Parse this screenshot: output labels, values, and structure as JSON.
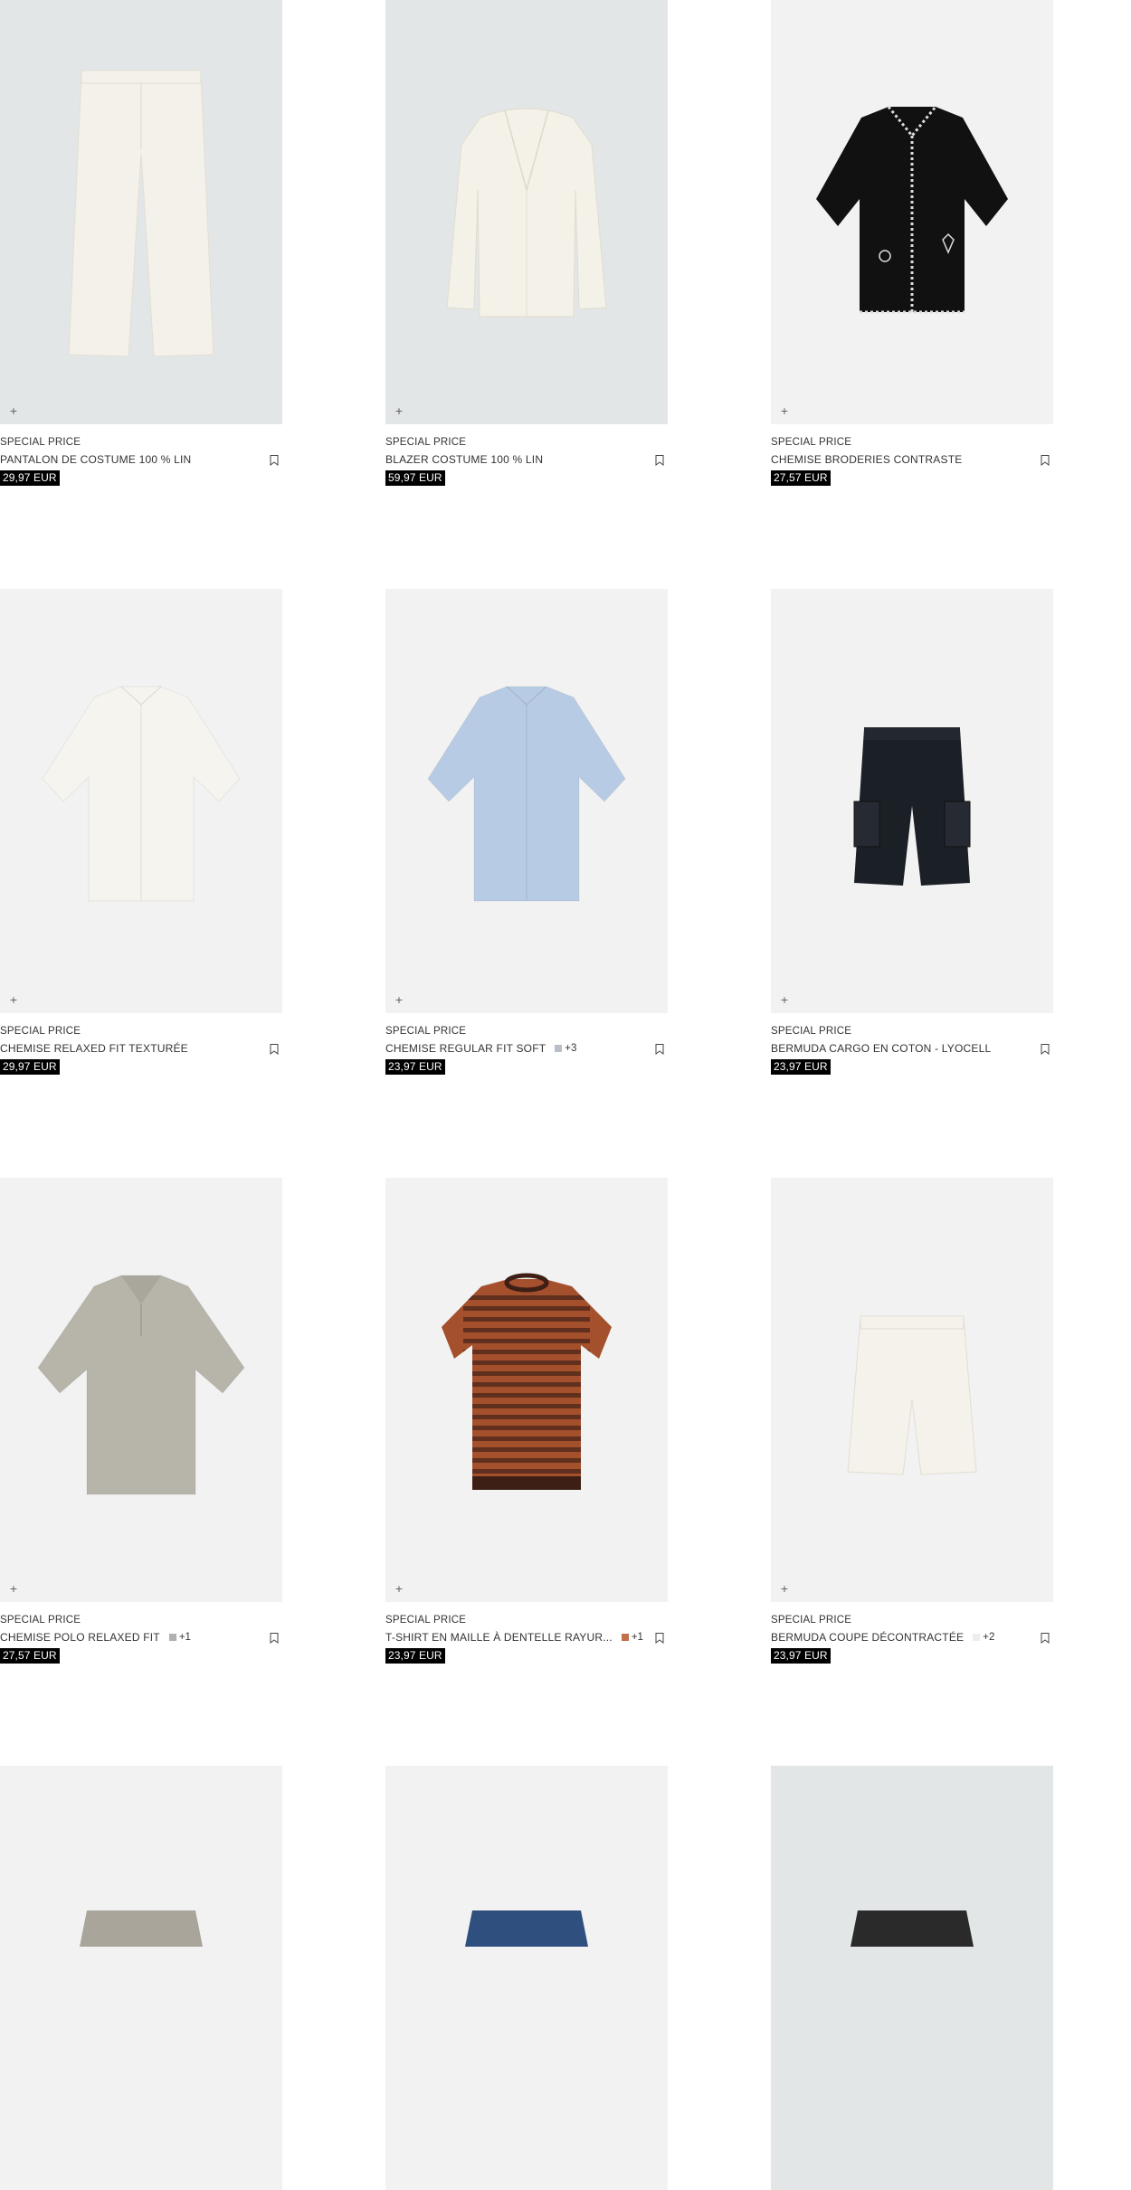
{
  "products": [
    {
      "tag": "SPECIAL PRICE",
      "name": "PANTALON DE COSTUME 100 % LIN",
      "price": "29,97 EUR",
      "bg": "#e3e6e7",
      "garment": "trousers",
      "color": "#f3f1ea",
      "swatch": null,
      "more": ""
    },
    {
      "tag": "SPECIAL PRICE",
      "name": "BLAZER COSTUME 100 % LIN",
      "price": "59,97 EUR",
      "bg": "#e3e6e7",
      "garment": "blazer",
      "color": "#f4f1e8",
      "swatch": null,
      "more": ""
    },
    {
      "tag": "SPECIAL PRICE",
      "name": "CHEMISE BRODERIES CONTRASTE",
      "price": "27,57 EUR",
      "bg": "#f2f2f2",
      "garment": "shirt-dark",
      "color": "#111111",
      "swatch": null,
      "more": ""
    },
    {
      "tag": "SPECIAL PRICE",
      "name": "CHEMISE RELAXED FIT TEXTURÉE",
      "price": "29,97 EUR",
      "bg": "#f2f2f2",
      "garment": "shirt",
      "color": "#f6f4ee",
      "swatch": null,
      "more": ""
    },
    {
      "tag": "SPECIAL PRICE",
      "name": "CHEMISE REGULAR FIT SOFT",
      "price": "23,97 EUR",
      "bg": "#f2f2f2",
      "garment": "shirt",
      "color": "#b8cbe4",
      "swatch": "#b9bfc6",
      "more": "+3"
    },
    {
      "tag": "SPECIAL PRICE",
      "name": "BERMUDA CARGO EN COTON - LYOCELL",
      "price": "23,97 EUR",
      "bg": "#f2f2f2",
      "garment": "cargo",
      "color": "#1b1f26",
      "swatch": null,
      "more": ""
    },
    {
      "tag": "SPECIAL PRICE",
      "name": "CHEMISE POLO RELAXED FIT",
      "price": "27,57 EUR",
      "bg": "#f2f2f2",
      "garment": "polo",
      "color": "#b7b4aa",
      "swatch": "#b0b0b0",
      "more": "+1"
    },
    {
      "tag": "SPECIAL PRICE",
      "name": "T-SHIRT EN MAILLE À DENTELLE RAYUR...",
      "price": "23,97 EUR",
      "bg": "#f2f2f2",
      "garment": "tee-stripe",
      "color": "#a5502d",
      "swatch": "#c0704a",
      "more": "+1"
    },
    {
      "tag": "SPECIAL PRICE",
      "name": "BERMUDA COUPE DÉCONTRACTÉE",
      "price": "23,97 EUR",
      "bg": "#f2f2f2",
      "garment": "shorts",
      "color": "#f4f2ea",
      "swatch": "#ededed",
      "more": "+2"
    },
    {
      "tag": "",
      "name": "",
      "price": "",
      "bg": "#f2f2f2",
      "garment": "partial",
      "color": "#a9a59b",
      "swatch": null,
      "more": ""
    },
    {
      "tag": "",
      "name": "",
      "price": "",
      "bg": "#f2f2f2",
      "garment": "partial",
      "color": "#2f4f7f",
      "swatch": null,
      "more": ""
    },
    {
      "tag": "",
      "name": "",
      "price": "",
      "bg": "#e3e6e7",
      "garment": "partial",
      "color": "#2a2a2a",
      "swatch": null,
      "more": ""
    }
  ],
  "icons": {
    "add": "plus-icon",
    "save": "bookmark-icon"
  }
}
